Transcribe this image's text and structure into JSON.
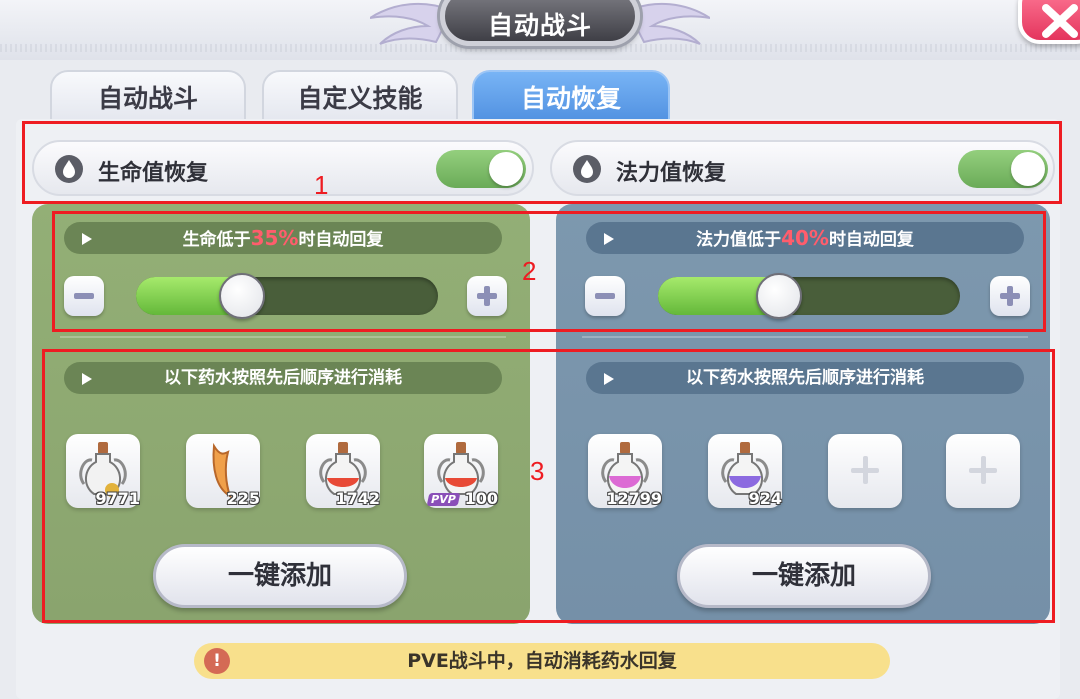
{
  "header": {
    "title": "自动战斗",
    "close_icon": "close-icon"
  },
  "tabs": [
    {
      "label": "自动战斗",
      "active": false
    },
    {
      "label": "自定义技能",
      "active": false
    },
    {
      "label": "自动恢复",
      "active": true
    }
  ],
  "hp": {
    "toggle_label": "生命值恢复",
    "toggle_on": true,
    "threshold_prefix": "生命低于",
    "threshold_value": "35%",
    "threshold_suffix": "时自动回复",
    "slider_fraction": 0.35,
    "order_text": "以下药水按照先后顺序进行消耗",
    "potions": [
      {
        "icon": "white-potion-icon",
        "qty": "9771"
      },
      {
        "icon": "horn-potion-icon",
        "qty": "225"
      },
      {
        "icon": "red-potion-icon",
        "qty": "1742"
      },
      {
        "icon": "pvp-red-potion-icon",
        "qty": "100",
        "tag": "PVP"
      }
    ],
    "add_button": "一键添加"
  },
  "mp": {
    "toggle_label": "法力值恢复",
    "toggle_on": true,
    "threshold_prefix": "法力值低于",
    "threshold_value": "40%",
    "threshold_suffix": "时自动回复",
    "slider_fraction": 0.4,
    "order_text": "以下药水按照先后顺序进行消耗",
    "potions": [
      {
        "icon": "pink-potion-icon",
        "qty": "12799"
      },
      {
        "icon": "purple-potion-icon",
        "qty": "924"
      }
    ],
    "empty_slots": 2,
    "add_button": "一键添加"
  },
  "annotations": [
    "1",
    "2",
    "3"
  ],
  "notice": "PVE战斗中，自动消耗药水回复",
  "colors": {
    "annotation_red": "#ee1c22",
    "tab_active": "#5a9be8",
    "hp_panel": "#8ea872",
    "mp_panel": "#7993aa",
    "switch_on": "#7dbc66",
    "threshold_highlight": "#ff5d6c",
    "notice_bg": "#f8e08c"
  }
}
